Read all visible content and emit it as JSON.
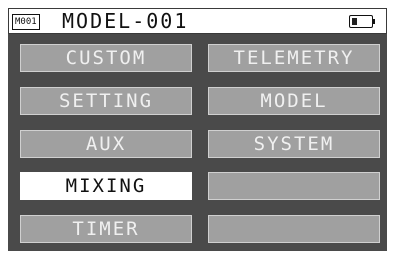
{
  "header": {
    "model_tag": "M001",
    "model_name": "MODEL-001",
    "battery_level": 0.3
  },
  "menu": {
    "custom": "CUSTOM",
    "telemetry": "TELEMETRY",
    "setting": "SETTING",
    "model": "MODEL",
    "aux": "AUX",
    "system": "SYSTEM",
    "mixing": "MIXING",
    "empty_1": "",
    "timer": "TIMER",
    "empty_2": "",
    "selected": "mixing"
  },
  "colors": {
    "screen_bg": "#4a4a4a",
    "button_bg": "#a0a0a0",
    "button_text": "#f0f0f0",
    "selected_bg": "#ffffff",
    "selected_text": "#111111"
  }
}
